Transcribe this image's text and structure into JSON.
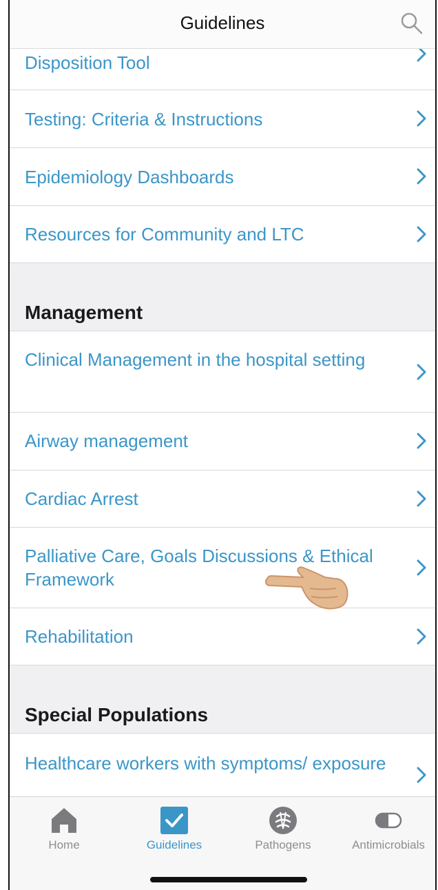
{
  "navbar": {
    "title": "Guidelines",
    "search_icon": "search-icon"
  },
  "rows_top": [
    {
      "label": "Disposition Tool"
    },
    {
      "label": "Testing: Criteria & Instructions"
    },
    {
      "label": "Epidemiology Dashboards"
    },
    {
      "label": "Resources for Community and LTC"
    }
  ],
  "sections": {
    "management": {
      "title": "Management",
      "rows": [
        {
          "label": "Clinical Management in the hospital setting"
        },
        {
          "label": "Airway management"
        },
        {
          "label": "Cardiac Arrest"
        },
        {
          "label": "Palliative Care, Goals Discussions & Ethical Framework"
        },
        {
          "label": "Rehabilitation"
        }
      ]
    },
    "special_populations": {
      "title": "Special Populations",
      "rows": [
        {
          "label": "Healthcare workers with symptoms/ exposure"
        }
      ]
    }
  },
  "annotation": {
    "icon": "pointing-hand-icon"
  },
  "tabbar": {
    "tabs": [
      {
        "label": "Home",
        "icon": "home-icon"
      },
      {
        "label": "Guidelines",
        "icon": "checklist-icon",
        "active": true
      },
      {
        "label": "Pathogens",
        "icon": "pathogen-icon"
      },
      {
        "label": "Antimicrobials",
        "icon": "pill-icon"
      }
    ]
  },
  "colors": {
    "accent": "#3b96c8",
    "separator": "#d8d8d8",
    "section_bg": "#f0f0f2"
  }
}
